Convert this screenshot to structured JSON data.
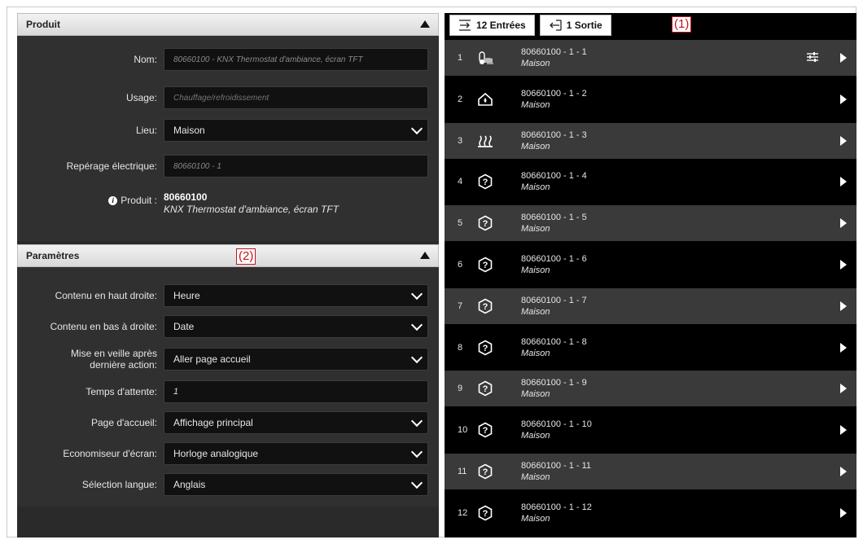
{
  "produit_panel": {
    "title": "Produit",
    "fields": [
      {
        "label": "Nom:",
        "value": "80660100 - KNX Thermostat d'ambiance, écran TFT"
      },
      {
        "label": "Usage:",
        "placeholder": "Chauffage/refroidissement"
      },
      {
        "label": "Lieu:",
        "value": "Maison"
      },
      {
        "label": "Repérage électrique:",
        "value": "80660100 - 1"
      }
    ],
    "info": {
      "label": "Produit :",
      "code": "80660100",
      "name": "KNX Thermostat d'ambiance, écran TFT"
    }
  },
  "parametres_panel": {
    "title": "Paramètres",
    "annotation": "(2)",
    "rows": [
      {
        "label": "Contenu en haut droite:",
        "value": "Heure"
      },
      {
        "label": "Contenu en bas à droite:",
        "value": "Date"
      },
      {
        "label": "Mise en veille après dernière action:",
        "value": "Aller page accueil"
      },
      {
        "label": "Temps d'attente:",
        "value": "1"
      },
      {
        "label": "Page d'accueil:",
        "value": "Affichage principal"
      },
      {
        "label": "Economiseur d'écran:",
        "value": "Horloge analogique"
      },
      {
        "label": "Sélection langue:",
        "value": "Anglais"
      }
    ]
  },
  "tabs": {
    "inputs_label": "12 Entrées",
    "outputs_label": "1 Sortie",
    "annotation": "(1)"
  },
  "channels": [
    {
      "num": "1",
      "title": "80660100 - 1 - 1",
      "sub": "Maison",
      "icon": "thermostat-icon"
    },
    {
      "num": "2",
      "title": "80660100 - 1 - 2",
      "sub": "Maison",
      "icon": "house-drop-icon"
    },
    {
      "num": "3",
      "title": "80660100 - 1 - 3",
      "sub": "Maison",
      "icon": "heating-icon"
    },
    {
      "num": "4",
      "title": "80660100 - 1 - 4",
      "sub": "Maison",
      "icon": "unknown-icon"
    },
    {
      "num": "5",
      "title": "80660100 - 1 - 5",
      "sub": "Maison",
      "icon": "unknown-icon"
    },
    {
      "num": "6",
      "title": "80660100 - 1 - 6",
      "sub": "Maison",
      "icon": "unknown-icon"
    },
    {
      "num": "7",
      "title": "80660100 - 1 - 7",
      "sub": "Maison",
      "icon": "unknown-icon"
    },
    {
      "num": "8",
      "title": "80660100 - 1 - 8",
      "sub": "Maison",
      "icon": "unknown-icon"
    },
    {
      "num": "9",
      "title": "80660100 - 1 - 9",
      "sub": "Maison",
      "icon": "unknown-icon"
    },
    {
      "num": "10",
      "title": "80660100 - 1 - 10",
      "sub": "Maison",
      "icon": "unknown-icon"
    },
    {
      "num": "11",
      "title": "80660100 - 1 - 11",
      "sub": "Maison",
      "icon": "unknown-icon"
    },
    {
      "num": "12",
      "title": "80660100 - 1 - 12",
      "sub": "Maison",
      "icon": "unknown-icon"
    }
  ],
  "colors": {
    "annotation": "#c0141c",
    "row_alt": "#3a3a3a",
    "row": "#000000"
  }
}
